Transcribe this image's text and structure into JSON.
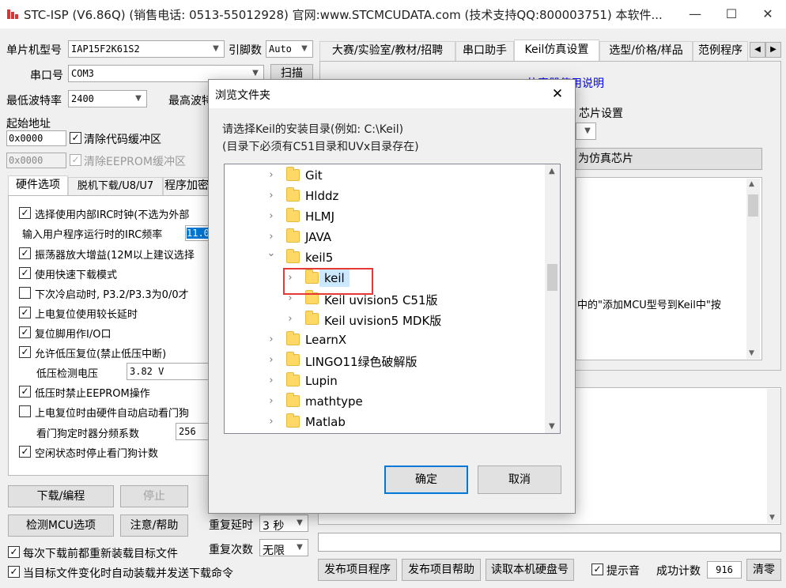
{
  "window": {
    "title": "STC-ISP (V6.86Q) (销售电话: 0513-55012928) 官网:www.STCMCUDATA.com  (技术支持QQ:800003751) 本软件...",
    "minimize": "—",
    "maximize": "☐",
    "close": "✕"
  },
  "left": {
    "chip_label": "单片机型号",
    "chip_value": "IAP15F2K61S2",
    "pins_label": "引脚数",
    "pins_value": "Auto",
    "port_label": "串口号",
    "port_value": "COM3",
    "scan_label": "扫描",
    "baud_min_label": "最低波特率",
    "baud_min_value": "2400",
    "baud_max_label": "最高波特率",
    "start_addr_label": "起始地址",
    "addr1_value": "0x0000",
    "clear_code_label": "清除代码缓冲区",
    "addr2_value": "0x0000",
    "clear_eeprom_label": "清除EEPROM缓冲区",
    "tabs": [
      "硬件选项",
      "脱机下载/U8/U7",
      "程序加密"
    ],
    "options": [
      {
        "label": "选择使用内部IRC时钟(不选为外部",
        "checked": true
      },
      {
        "label": "振荡器放大增益(12M以上建议选择",
        "checked": true
      },
      {
        "label": "使用快速下载模式",
        "checked": true
      },
      {
        "label": "下次冷启动时, P3.2/P3.3为0/0才",
        "checked": false
      },
      {
        "label": "上电复位使用较长延时",
        "checked": true
      },
      {
        "label": "复位脚用作I/O口",
        "checked": true
      },
      {
        "label": "允许低压复位(禁止低压中断)",
        "checked": true
      },
      {
        "label": "低压时禁止EEPROM操作",
        "checked": true
      },
      {
        "label": "上电复位时由硬件自动启动看门狗",
        "checked": false
      },
      {
        "label": "空闲状态时停止看门狗计数",
        "checked": true
      }
    ],
    "irc_label": "输入用户程序运行时的IRC频率",
    "irc_value": "11.0",
    "lvd_label": "低压检测电压",
    "lvd_value": "3.82 V",
    "wdt_label": "看门狗定时器分频系数",
    "wdt_value": "256",
    "download_btn": "下载/编程",
    "stop_btn": "停止",
    "detect_btn": "检测MCU选项",
    "help_btn": "注意/帮助",
    "repeat_delay_label": "重复延时",
    "repeat_delay_value": "3 秒",
    "repeat_count_label": "重复次数",
    "repeat_count_value": "无限",
    "reload_label": "每次下载前都重新装载目标文件",
    "auto_label": "当目标文件变化时自动装载并发送下载命令"
  },
  "right": {
    "tabs": [
      "大赛/实验室/教材/招聘",
      "串口助手",
      "Keil仿真设置",
      "选型/价格/样品",
      "范例程序"
    ],
    "manual_link": "仿真器使用说明",
    "chip_settings": "芯片设置",
    "set_chip_btn": "为仿真芯片",
    "info_text": "中的\"添加MCU型号到Keil中\"按",
    "publish_prog_btn": "发布项目程序",
    "publish_help_btn": "发布项目帮助",
    "read_disk_btn": "读取本机硬盘号",
    "beep_label": "提示音",
    "success_label": "成功计数",
    "success_value": "916",
    "clear_btn": "清零"
  },
  "dialog": {
    "title": "浏览文件夹",
    "close": "✕",
    "hint1": "请选择Keil的安装目录(例如: C:\\Keil)",
    "hint2": "(目录下必须有C51目录和UVx目录存在)",
    "tree": [
      {
        "name": "Git",
        "level": 0,
        "expanded": false,
        "selected": false
      },
      {
        "name": "Hlddz",
        "level": 0,
        "expanded": false,
        "selected": false
      },
      {
        "name": "HLMJ",
        "level": 0,
        "expanded": false,
        "selected": false
      },
      {
        "name": "JAVA",
        "level": 0,
        "expanded": false,
        "selected": false
      },
      {
        "name": "keil5",
        "level": 0,
        "expanded": true,
        "selected": false
      },
      {
        "name": "keil",
        "level": 1,
        "expanded": false,
        "selected": true
      },
      {
        "name": "Keil uvision5 C51版",
        "level": 1,
        "expanded": false,
        "selected": false
      },
      {
        "name": "Keil uvision5 MDK版",
        "level": 1,
        "expanded": false,
        "selected": false
      },
      {
        "name": "LearnX",
        "level": 0,
        "expanded": false,
        "selected": false
      },
      {
        "name": "LINGO11绿色破解版",
        "level": 0,
        "expanded": false,
        "selected": false
      },
      {
        "name": "Lupin",
        "level": 0,
        "expanded": false,
        "selected": false
      },
      {
        "name": "mathtype",
        "level": 0,
        "expanded": false,
        "selected": false
      },
      {
        "name": "Matlab",
        "level": 0,
        "expanded": false,
        "selected": false
      }
    ],
    "ok_label": "确定",
    "cancel_label": "取消"
  },
  "colors": {
    "accent": "#0078d7",
    "highlight": "#e53935",
    "selection": "#cce8ff"
  }
}
